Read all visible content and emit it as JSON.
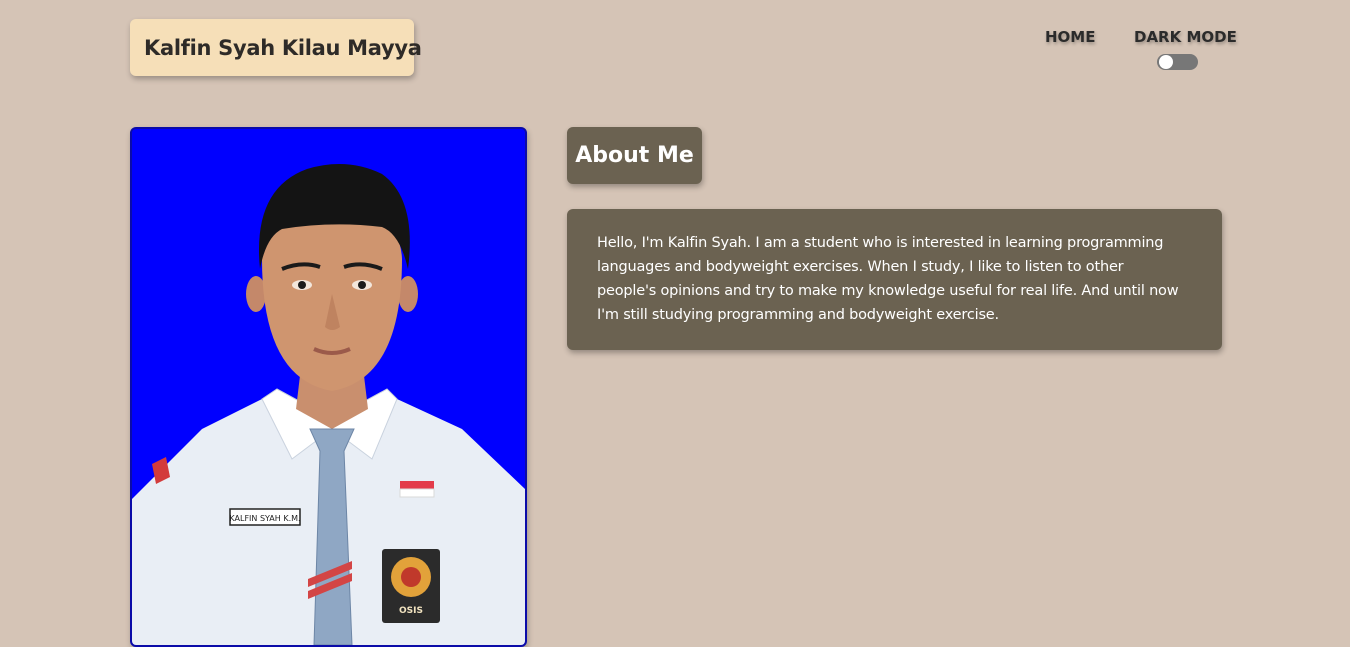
{
  "header": {
    "brand_name": "Kalfin Syah Kilau Mayya",
    "nav": {
      "home_label": "HOME",
      "dark_mode_label": "DARK MODE"
    },
    "dark_mode_toggle": {
      "on": false
    }
  },
  "profile_photo": {
    "name_tag_text": "KALFIN SYAH K.M.",
    "badge_text": "OSIS"
  },
  "about": {
    "title": "About Me",
    "body": "Hello, I'm Kalfin Syah. I am a student who is interested in learning programming languages and bodyweight exercises. When I study, I like to listen to other people's opinions and try to make my knowledge useful for real life. And until now I'm still studying programming and bodyweight exercise."
  },
  "colors": {
    "page_background": "#d5c4b6",
    "brand_background": "#f6dfb8",
    "card_background": "#6b6251",
    "photo_background": "#0000ff"
  }
}
